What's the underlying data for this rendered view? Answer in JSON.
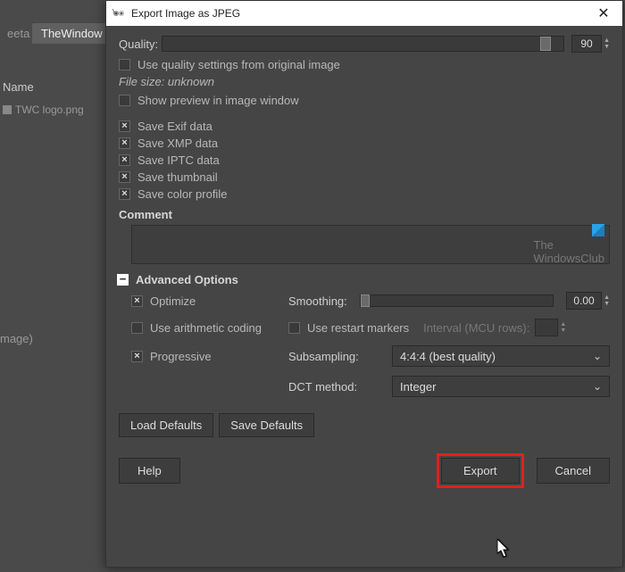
{
  "background": {
    "tab_other": "eeta",
    "tab_active": "TheWindow",
    "name_header": "Name",
    "file_item": "TWC logo.png",
    "image_label": "mage)"
  },
  "dialog": {
    "title": "Export Image as JPEG",
    "close_glyph": "✕",
    "quality": {
      "label": "Quality:",
      "value": "90"
    },
    "chk_use_orig": "Use quality settings from original image",
    "file_size": "File size: unknown",
    "chk_preview": "Show preview in image window",
    "chk_exif": "Save Exif data",
    "chk_xmp": "Save XMP data",
    "chk_iptc": "Save IPTC data",
    "chk_thumb": "Save thumbnail",
    "chk_color": "Save color profile",
    "comment_label": "Comment",
    "adv_label": "Advanced Options",
    "chk_optimize": "Optimize",
    "smoothing_label": "Smoothing:",
    "smoothing_value": "0.00",
    "chk_arith": "Use arithmetic coding",
    "chk_restart": "Use restart markers",
    "interval_label": "Interval (MCU rows):",
    "chk_progressive": "Progressive",
    "subsampling_label": "Subsampling:",
    "subsampling_value": "4:4:4 (best quality)",
    "dct_label": "DCT method:",
    "dct_value": "Integer",
    "load_defaults": "Load Defaults",
    "save_defaults": "Save Defaults",
    "help": "Help",
    "export": "Export",
    "cancel": "Cancel"
  },
  "watermark": {
    "line1": "The",
    "line2": "WindowsClub"
  }
}
